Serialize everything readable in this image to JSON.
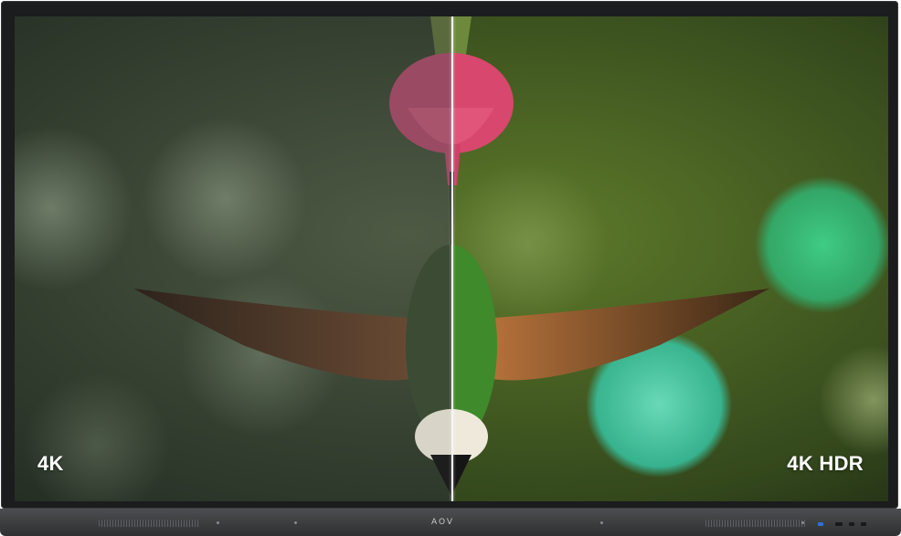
{
  "labels": {
    "left": "4K",
    "right": "4K HDR"
  },
  "device": {
    "brand": "AOV"
  },
  "icons": [
    "usb-port-icon",
    "hdmi-port-icon",
    "button-icon"
  ]
}
